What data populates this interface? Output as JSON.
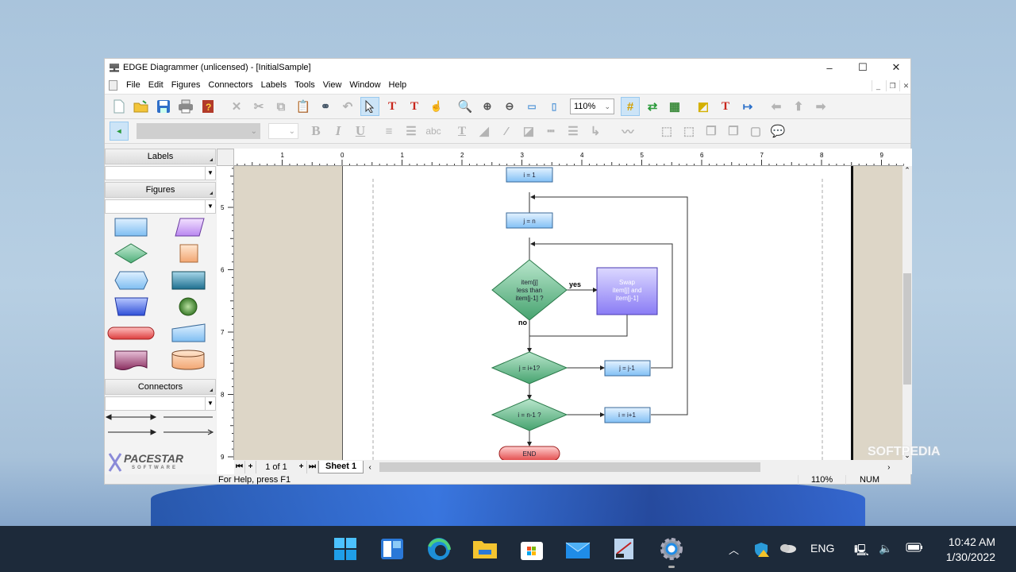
{
  "window": {
    "title": "EDGE Diagrammer (unlicensed) - [InitialSample]",
    "minimize": "–",
    "maximize": "☐",
    "close": "✕"
  },
  "menu": [
    "File",
    "Edit",
    "Figures",
    "Connectors",
    "Labels",
    "Tools",
    "View",
    "Window",
    "Help"
  ],
  "toolbar1": {
    "icons": [
      "new-document",
      "open-folder",
      "save",
      "print",
      "help-book",
      "delete",
      "cut",
      "copy",
      "paste",
      "find-binoculars",
      "undo",
      "select-pointer",
      "text-pointer",
      "text-tool",
      "connector-point-tool",
      "zoom",
      "zoom-in",
      "zoom-out",
      "zoom-page-width",
      "zoom-page",
      "grid",
      "change-figure",
      "insert-image",
      "figure-properties",
      "text-properties",
      "connector-properties",
      "move-left",
      "move-up",
      "move-right"
    ],
    "zoom_value": "110%"
  },
  "toolbar2": {
    "icons": [
      "sheet-toggle",
      "font-name",
      "font-size",
      "bold",
      "italic",
      "underline",
      "align-left",
      "align-center",
      "abc-spell",
      "text-color",
      "line-color",
      "fill-color",
      "shadow",
      "line-style-dashed",
      "line-weight",
      "arrow-style",
      "curve-connector",
      "group",
      "ungroup",
      "bring-forward",
      "send-backward",
      "bring-front",
      "callout"
    ],
    "bold": "B",
    "italic": "I",
    "underline": "U",
    "abc": "abc"
  },
  "left_panel": {
    "sections": [
      {
        "title": "Labels"
      },
      {
        "title": "Figures"
      },
      {
        "title": "Connectors"
      }
    ],
    "logo": "PACESTAR",
    "logo_sub": "SOFTWARE"
  },
  "ruler": {
    "h_ticks": [
      "1",
      "0",
      "1",
      "2",
      "3",
      "4",
      "5",
      "6",
      "7",
      "8",
      "9"
    ],
    "v_ticks": [
      "5",
      "6",
      "7",
      "8",
      "9"
    ]
  },
  "diagram": {
    "nodes": [
      {
        "id": "i1",
        "type": "process",
        "label": "i = 1"
      },
      {
        "id": "jn",
        "type": "process",
        "label": "j = n"
      },
      {
        "id": "cmp",
        "type": "decision",
        "label": [
          "item[j]",
          "less than",
          "item[j-1] ?"
        ]
      },
      {
        "id": "swap",
        "type": "process-highlight",
        "label": [
          "Swap",
          "item[j] and",
          "item[j-1]"
        ]
      },
      {
        "id": "ji1",
        "type": "decision",
        "label": "j = i+1?"
      },
      {
        "id": "jm1",
        "type": "process",
        "label": "j = j-1"
      },
      {
        "id": "in1",
        "type": "decision",
        "label": "i = n-1 ?"
      },
      {
        "id": "ip1",
        "type": "process",
        "label": "i = i+1"
      },
      {
        "id": "end",
        "type": "terminator",
        "label": "END"
      }
    ],
    "edge_labels": {
      "yes": "yes",
      "no": "no"
    }
  },
  "sheet_nav": {
    "page": "1 of 1",
    "tab": "Sheet 1"
  },
  "status": {
    "help": "For Help, press F1",
    "zoom": "110%",
    "num": "NUM"
  },
  "watermark": "SOFTPEDIA",
  "taskbar": {
    "apps": [
      "start",
      "widgets",
      "edge",
      "file-explorer",
      "store",
      "mail",
      "diagrammer",
      "settings"
    ],
    "lang": "ENG",
    "time": "10:42 AM",
    "date": "1/30/2022"
  }
}
